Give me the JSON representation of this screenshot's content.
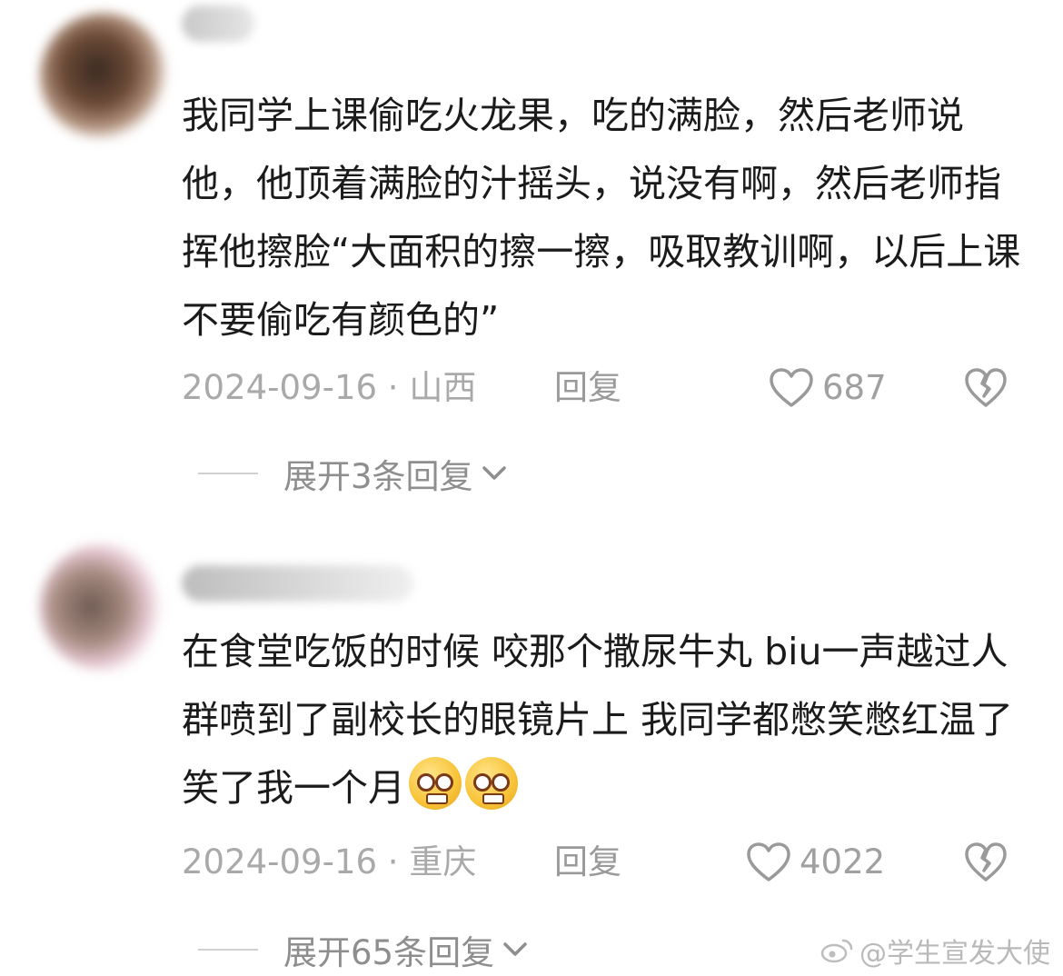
{
  "comments": [
    {
      "text": "我同学上课偷吃火龙果，吃的满脸，然后老师说他，他顶着满脸的汁摇头，说没有啊，然后老师指挥他擦脸“大面积的擦一擦，吸取教训啊，以后上课不要偷吃有颜色的”",
      "date": "2024-09-16",
      "separator": " · ",
      "location": "山西",
      "reply_label": "回复",
      "likes": "687",
      "expand_label": "展开3条回复"
    },
    {
      "text": "在食堂吃饭的时候 咬那个撒尿牛丸 biu一声越过人群喷到了副校长的眼镜片上 我同学都憋笑憋红温了 笑了我一个月",
      "emoji": "pleading-face-emoji",
      "date": "2024-09-16",
      "separator": " · ",
      "location": "重庆",
      "reply_label": "回复",
      "likes": "4022",
      "expand_label": "展开65条回复"
    }
  ],
  "watermark": "@学生宣发大使",
  "icons": {
    "like": "heart-outline-icon",
    "dislike": "broken-heart-icon",
    "expand": "chevron-down-icon",
    "watermark": "weibo-logo-icon"
  },
  "colors": {
    "text": "#1b1b1b",
    "meta": "#a9a9a9",
    "emoji": "#f7c338"
  }
}
